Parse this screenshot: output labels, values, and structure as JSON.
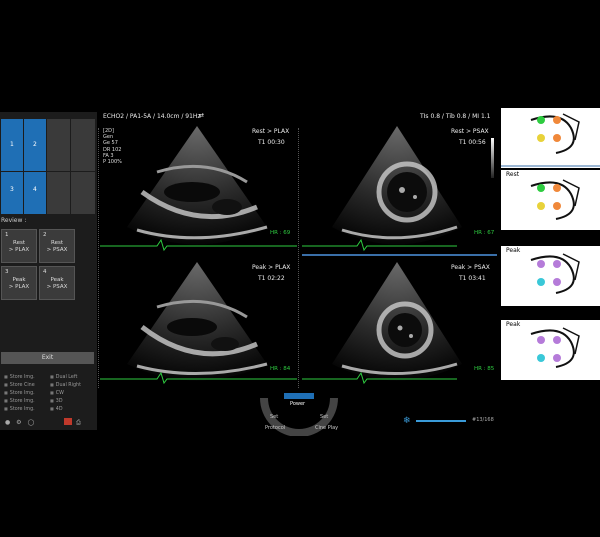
{
  "header": {
    "probe": "ECHO2 / PA1-5A / 14.0cm / 91Hz",
    "tis": "TIs  0.8 / Tib  0.8 / MI   1.1"
  },
  "params": {
    "mode": "[2D]",
    "gen": "Gen",
    "ge": "Ge  57",
    "dr": "DR  102",
    "fa": "FA  3",
    "p": "P   100%"
  },
  "grid": [
    "1",
    "2",
    "3",
    "4"
  ],
  "review": {
    "title": "Review :",
    "buttons": [
      {
        "num": "1",
        "line1": "Rest",
        "line2": "> PLAX"
      },
      {
        "num": "2",
        "line1": "Rest",
        "line2": "> PSAX"
      },
      {
        "num": "3",
        "line1": "Peak",
        "line2": "> PLAX"
      },
      {
        "num": "4",
        "line1": "Peak",
        "line2": "> PSAX"
      }
    ],
    "exit_label": "Exit"
  },
  "store_items": {
    "left": [
      "Store Img.",
      "Store Cine",
      "Store Img.",
      "Store Img.",
      "Store Img."
    ],
    "right": [
      "Dual Left",
      "Dual Right",
      "CW",
      "3D",
      "4D"
    ]
  },
  "views": [
    {
      "title": "Rest > PLAX",
      "time": "T1  00:30",
      "hr": "HR : 69"
    },
    {
      "title": "Rest > PSAX",
      "time": "T1  00:56",
      "hr": "HR : 67"
    },
    {
      "title": "Peak > PLAX",
      "time": "T1  02:22",
      "hr": "HR : 84"
    },
    {
      "title": "Peak > PSAX",
      "time": "T1  03:41",
      "hr": "HR : 85"
    }
  ],
  "thumbs": {
    "labels": [
      "Rest",
      "Peak",
      "Peak"
    ]
  },
  "controls": {
    "center": "Power",
    "set_left": "Set",
    "set_right": "Set",
    "protocol": "Protocol",
    "cine_play": "Cine Play",
    "frame_counter": "#13/168"
  },
  "colors": {
    "accent_blue": "#1f6fb5",
    "hr_green": "#2ecc40",
    "seg_green": "#2ecc40",
    "seg_orange": "#f0883a",
    "seg_yellow": "#e8d23a",
    "seg_purple": "#b57bd9",
    "seg_cyan": "#3ac8d8"
  }
}
